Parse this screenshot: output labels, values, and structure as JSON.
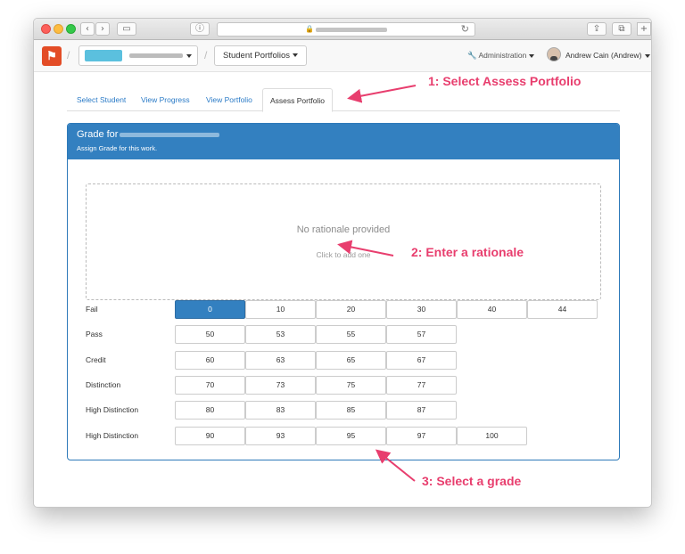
{
  "browser": {
    "back_label": "‹",
    "forward_label": "›",
    "sidebar_label": "▭",
    "privacy_label": "ⓘ",
    "lock_glyph": "🔒",
    "reload_label": "↻",
    "share_label": "⇪",
    "tabs_label": "⧉",
    "new_tab_label": "+"
  },
  "navbar": {
    "logo_glyph": "⚑",
    "separator": "/",
    "portfolios_dropdown": "Student Portfolios",
    "administration": "Administration",
    "user_name": "Andrew Cain (Andrew)"
  },
  "tabs": [
    {
      "label": "Select Student",
      "active": false
    },
    {
      "label": "View Progress",
      "active": false
    },
    {
      "label": "View Portfolio",
      "active": false
    },
    {
      "label": "Assess Portfolio",
      "active": true
    }
  ],
  "panel": {
    "title_prefix": "Grade for",
    "subtitle": "Assign Grade for this work."
  },
  "rationale": {
    "title": "No rationale provided",
    "hint": "Click to add one"
  },
  "grades": {
    "selected": "0",
    "rows": [
      {
        "label": "Fail",
        "values": [
          "0",
          "10",
          "20",
          "30",
          "40",
          "44"
        ]
      },
      {
        "label": "Pass",
        "values": [
          "50",
          "53",
          "55",
          "57"
        ]
      },
      {
        "label": "Credit",
        "values": [
          "60",
          "63",
          "65",
          "67"
        ]
      },
      {
        "label": "Distinction",
        "values": [
          "70",
          "73",
          "75",
          "77"
        ]
      },
      {
        "label": "High Distinction",
        "values": [
          "80",
          "83",
          "85",
          "87"
        ]
      },
      {
        "label": "High Distinction",
        "values": [
          "90",
          "93",
          "95",
          "97",
          "100"
        ]
      }
    ]
  },
  "annotations": {
    "step1": "1: Select Assess Portfolio",
    "step2": "2: Enter a rationale",
    "step3": "3: Select a grade",
    "color": "#e83e6e"
  },
  "colors": {
    "accent": "#3380c0",
    "link": "#2b7bc7"
  }
}
